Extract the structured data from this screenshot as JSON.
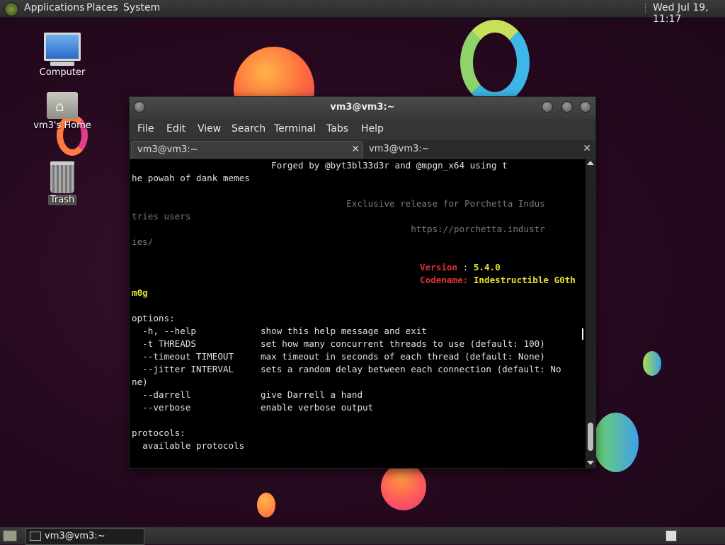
{
  "top_panel": {
    "menus": [
      "Applications",
      "Places",
      "System"
    ],
    "clock": "Wed Jul 19, 11:17"
  },
  "desktop": {
    "icons": [
      {
        "label": "Computer"
      },
      {
        "label": "vm3's Home"
      },
      {
        "label": "Trash"
      }
    ]
  },
  "window": {
    "title": "vm3@vm3:~",
    "menu": [
      "File",
      "Edit",
      "View",
      "Search",
      "Terminal",
      "Tabs",
      "Help"
    ],
    "tabs": [
      {
        "label": "vm3@vm3:~",
        "active": true
      },
      {
        "label": "vm3@vm3:~",
        "active": false
      }
    ]
  },
  "terminal": {
    "lines": [
      "                          Forged by @byt3bl33d3r and @mpgn_x64 using t",
      "he powah of dank memes",
      "",
      "                                        Exclusive release for Porchetta Indus",
      "tries users",
      "                                                    https://porchetta.industr",
      "ies/",
      "",
      "",
      "",
      "m0g",
      "",
      "options:",
      "  -h, --help            show this help message and exit",
      "  -t THREADS            set how many concurrent threads to use (default: 100)",
      "  --timeout TIMEOUT     max timeout in seconds of each thread (default: None)",
      "  --jitter INTERVAL     sets a random delay between each connection (default: No",
      "ne)",
      "  --darrell             give Darrell a hand",
      "  --verbose             enable verbose output",
      "",
      "protocols:",
      "  available protocols"
    ],
    "version_label": "Version",
    "version_sep": " : ",
    "version_value": "5.4.0",
    "codename_label": "Codename:",
    "codename_value": " Indestructible G0th"
  },
  "taskbar": {
    "task_label": "vm3@vm3:~"
  },
  "colors": {
    "accent_red": "#e03030",
    "accent_yellow": "#e8e030"
  }
}
